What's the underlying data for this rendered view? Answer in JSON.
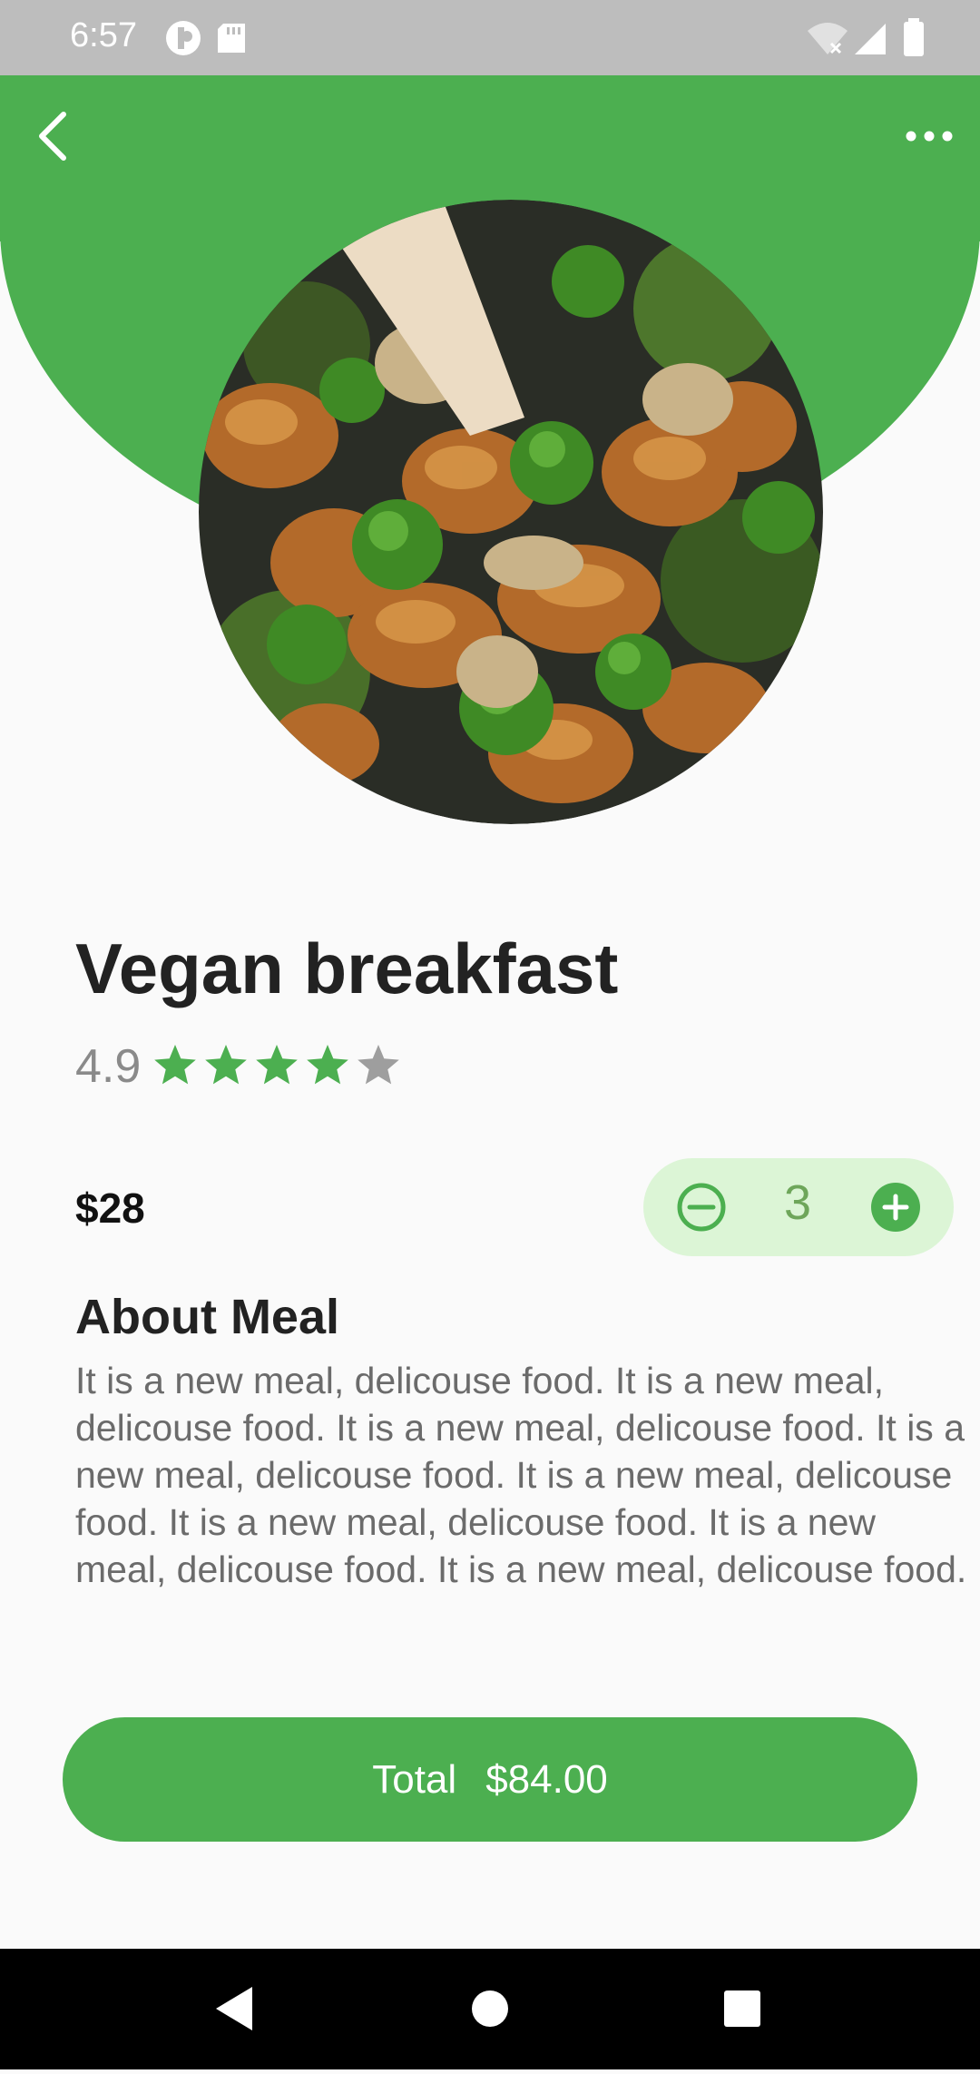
{
  "status_bar": {
    "time": "6:57",
    "left_icons": [
      "app-notification-icon",
      "sd-card-icon"
    ],
    "right_icons": [
      "wifi-off-icon",
      "cellular-signal-icon",
      "battery-icon"
    ]
  },
  "toolbar": {
    "back_icon": "back-arrow-icon",
    "more_icon": "more-options-icon"
  },
  "meal": {
    "title": "Vegan breakfast",
    "rating": "4.9",
    "stars_filled": 4,
    "stars_total": 5,
    "price": "$28",
    "quantity": "3",
    "about_title": "About Meal",
    "about_text": "It is a new meal, delicouse food. It is a new meal, delicouse food. It is a new meal, delicouse food. It is a new meal, delicouse food. It is a new meal, delicouse food. It is a new meal, delicouse food. It is a new meal, delicouse food. It is a new meal, delicouse food."
  },
  "total_button": {
    "label": "Total",
    "amount": "$84.00"
  },
  "colors": {
    "accent": "#4caf50",
    "star_filled": "#4caf50",
    "star_empty": "#9e9e9e",
    "qty_pill_bg": "#dcf5d6"
  },
  "nav_bar": [
    "back-nav-icon",
    "home-nav-icon",
    "recents-nav-icon"
  ]
}
